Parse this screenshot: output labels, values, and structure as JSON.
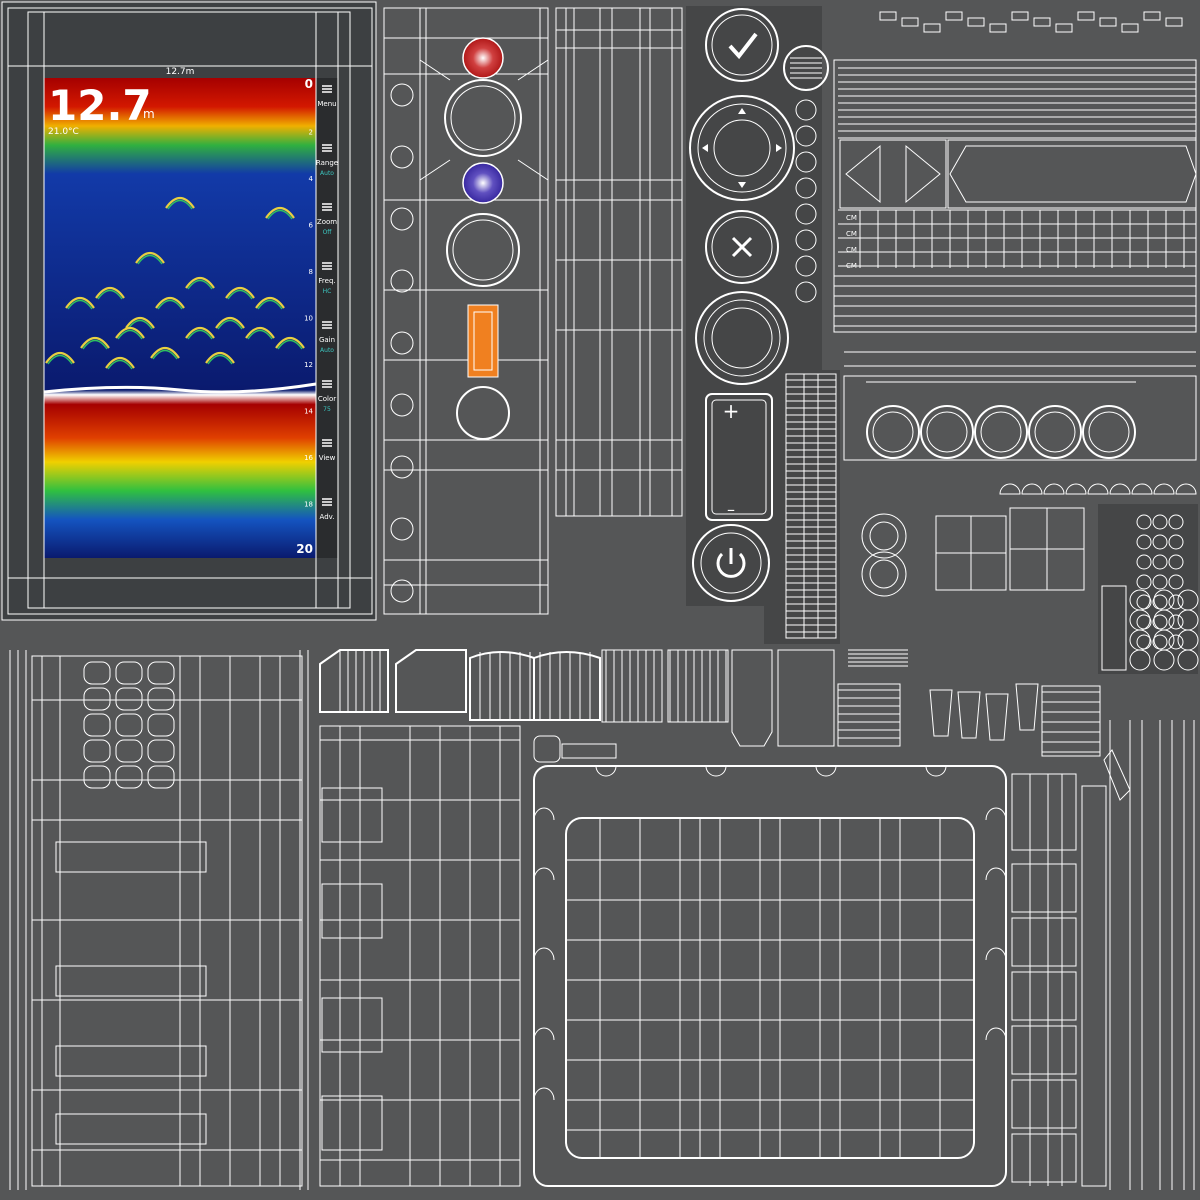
{
  "sonar": {
    "depth_value": "12.7",
    "depth_unit": "m",
    "range_top": "12.7m",
    "temperature": "21.0°C",
    "scale_values": [
      "0",
      "2",
      "4",
      "6",
      "8",
      "10",
      "12",
      "14",
      "16",
      "18",
      "20"
    ],
    "menu_items": [
      {
        "label": "Menu",
        "value": ""
      },
      {
        "label": "Range",
        "value": "Auto"
      },
      {
        "label": "Zoom",
        "value": "Off"
      },
      {
        "label": "Freq.",
        "value": "HC"
      },
      {
        "label": "Gain",
        "value": "Auto"
      },
      {
        "label": "Color",
        "value": "75"
      },
      {
        "label": "View",
        "value": ""
      },
      {
        "label": "Adv.",
        "value": ""
      }
    ],
    "colors": {
      "surface": "#a50000",
      "deep": "#0a1a6e",
      "background": "#3d4042",
      "accent": "#3cc6c0"
    }
  },
  "buttons": {
    "check_icon": "checkmark-icon",
    "close_icon": "x-icon",
    "power_icon": "power-icon",
    "plus_label": "+",
    "minus_label": "–"
  },
  "texture_labels": [
    "CM",
    "CM",
    "CM",
    "CM"
  ]
}
